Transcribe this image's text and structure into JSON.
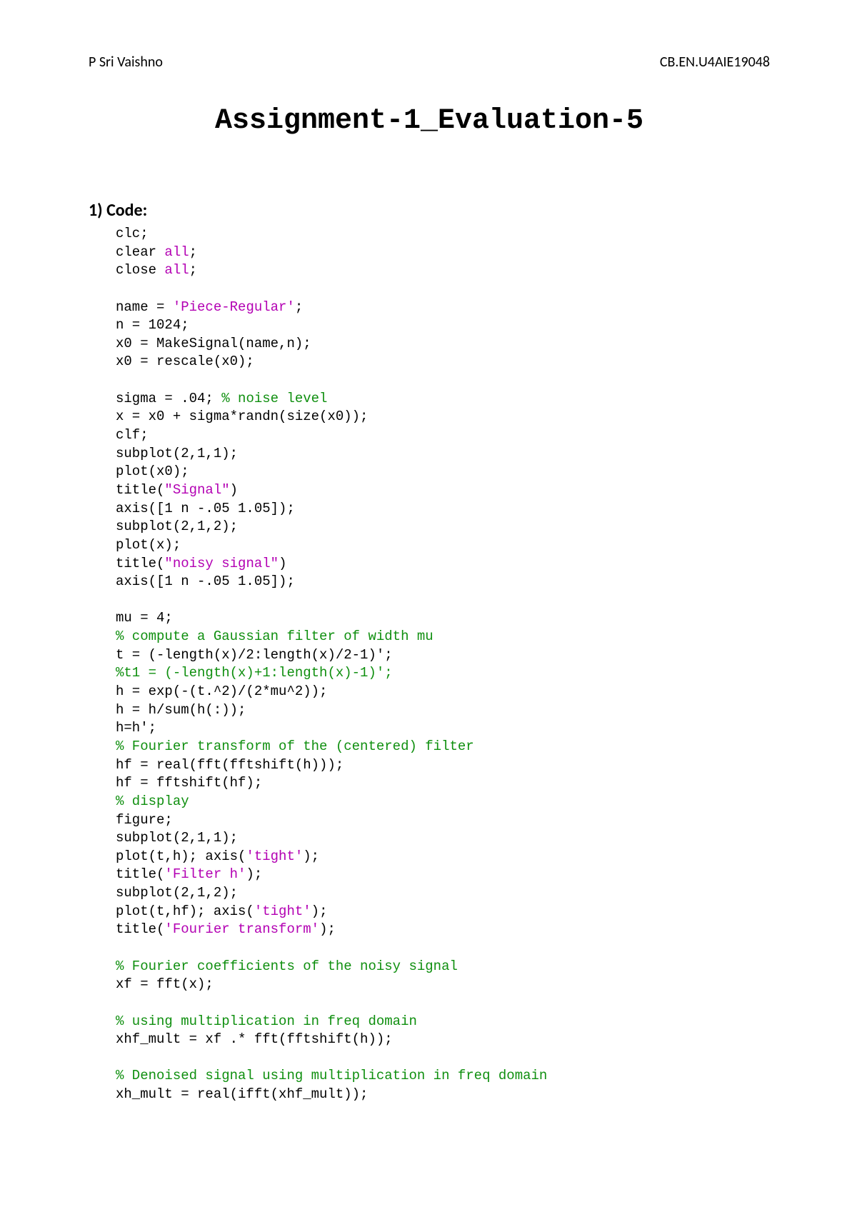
{
  "header": {
    "left": "P Sri Vaishno",
    "right": "CB.EN.U4AIE19048"
  },
  "title": "Assignment-1_Evaluation-5",
  "section": "1) Code:",
  "code": {
    "l01": "clc;",
    "l02a": "clear ",
    "l02b": "all",
    "l02c": ";",
    "l03a": "close ",
    "l03b": "all",
    "l03c": ";",
    "l05a": "name = ",
    "l05b": "'Piece-Regular'",
    "l05c": ";",
    "l06": "n = 1024;",
    "l07": "x0 = MakeSignal(name,n);",
    "l08": "x0 = rescale(x0);",
    "l10a": "sigma = .04; ",
    "l10b": "% noise level",
    "l11": "x = x0 + sigma*randn(size(x0));",
    "l12": "clf;",
    "l13": "subplot(2,1,1);",
    "l14": "plot(x0);",
    "l15a": "title(",
    "l15b": "\"Signal\"",
    "l15c": ")",
    "l16": "axis([1 n -.05 1.05]);",
    "l17": "subplot(2,1,2);",
    "l18": "plot(x);",
    "l19a": "title(",
    "l19b": "\"noisy signal\"",
    "l19c": ")",
    "l20": "axis([1 n -.05 1.05]);",
    "l22": "mu = 4;",
    "l23": "% compute a Gaussian filter of width mu",
    "l24": "t = (-length(x)/2:length(x)/2-1)';",
    "l25": "%t1 = (-length(x)+1:length(x)-1)';",
    "l26": "h = exp(-(t.^2)/(2*mu^2));",
    "l27": "h = h/sum(h(:));",
    "l28": "h=h';",
    "l29": "% Fourier transform of the (centered) filter",
    "l30": "hf = real(fft(fftshift(h)));",
    "l31": "hf = fftshift(hf);",
    "l32": "% display",
    "l33": "figure;",
    "l34": "subplot(2,1,1);",
    "l35a": "plot(t,h); axis(",
    "l35b": "'tight'",
    "l35c": ");",
    "l36a": "title(",
    "l36b": "'Filter h'",
    "l36c": ");",
    "l37": "subplot(2,1,2);",
    "l38a": "plot(t,hf); axis(",
    "l38b": "'tight'",
    "l38c": ");",
    "l39a": "title(",
    "l39b": "'Fourier transform'",
    "l39c": ");",
    "l41": "% Fourier coefficients of the noisy signal",
    "l42": "xf = fft(x);",
    "l44": "% using multiplication in freq domain",
    "l45": "xhf_mult = xf .* fft(fftshift(h));",
    "l47": "% Denoised signal using multiplication in freq domain",
    "l48": "xh_mult = real(ifft(xhf_mult));"
  }
}
